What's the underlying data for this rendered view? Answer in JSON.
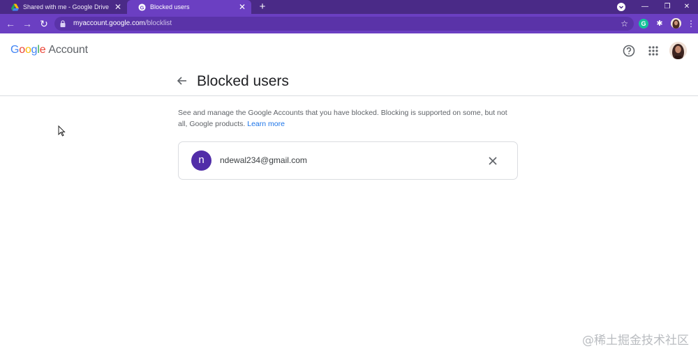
{
  "browser": {
    "tabs": [
      {
        "title": "Shared with me - Google Drive",
        "close": "✕"
      },
      {
        "title": "Blocked users",
        "close": "✕"
      }
    ],
    "new_tab": "+",
    "window": {
      "minimize": "—",
      "restore": "❐",
      "close": "✕"
    },
    "url_host": "myaccount.google.com",
    "url_path": "/blocklist",
    "extension_grammarly": "G"
  },
  "header": {
    "logo_google": [
      "G",
      "o",
      "o",
      "g",
      "l",
      "e"
    ],
    "logo_account": "Account"
  },
  "page": {
    "title": "Blocked users",
    "description": "See and manage the Google Accounts that you have blocked. Blocking is supported on some, but not all, Google products.",
    "learn_more": "Learn more"
  },
  "blocked_users": [
    {
      "initial": "n",
      "email": "ndewal234@gmail.com"
    }
  ],
  "watermark": "@稀土掘金技术社区",
  "colors": {
    "chrome_tabbar": "#4a2a87",
    "chrome_toolbar": "#6b3fc2",
    "avatar": "#512da8",
    "link": "#1a73e8"
  }
}
